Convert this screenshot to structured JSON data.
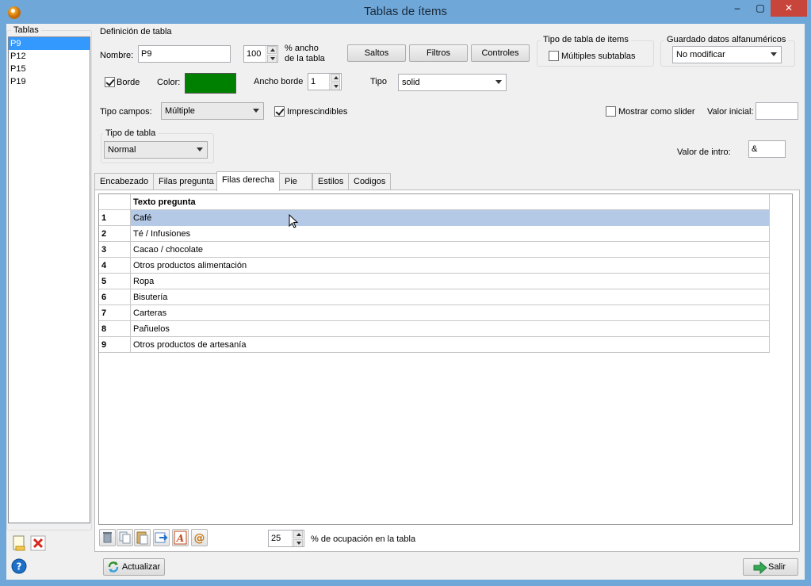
{
  "window": {
    "title": "Tablas de ítems",
    "minimize": "–",
    "maximize": "▢",
    "close": "✕"
  },
  "tables_panel": {
    "title": "Tablas",
    "items": [
      "P9",
      "P12",
      "P15",
      "P19"
    ],
    "selected": "P9"
  },
  "definition": {
    "group_title": "Definición de tabla",
    "name_label": "Nombre:",
    "name_value": "P9",
    "width_value": "100",
    "width_label_1": "% ancho",
    "width_label_2": "de la tabla",
    "btn_saltos": "Saltos",
    "btn_filtros": "Filtros",
    "btn_controles": "Controles",
    "border_label": "Borde",
    "border_checked": true,
    "color_label": "Color:",
    "color_value": "#008000",
    "border_width_label": "Ancho borde",
    "border_width_value": "1",
    "type_label": "Tipo",
    "type_value": "solid",
    "field_type_label": "Tipo campos:",
    "field_type_value": "Múltiple",
    "required_label": "Imprescindibles",
    "required_checked": true,
    "table_type_group": "Tipo de tabla",
    "table_type_value": "Normal"
  },
  "item_table_type": {
    "group_title": "Tipo de tabla de items",
    "multi_label": "Múltiples subtablas",
    "multi_checked": false
  },
  "alpha_data": {
    "group_title": "Guardado datos alfanuméricos",
    "value": "No modificar"
  },
  "slider": {
    "label": "Mostrar como slider",
    "checked": false,
    "initial_label": "Valor inicial:",
    "initial_value": ""
  },
  "intro": {
    "label": "Valor  de intro:",
    "value": "&"
  },
  "tabs": [
    {
      "label": "Encabezado",
      "active": false
    },
    {
      "label": "Filas pregunta",
      "active": false
    },
    {
      "label": "Filas derecha",
      "active": true
    },
    {
      "label": "Pie",
      "active": false
    },
    {
      "label": "Estilos",
      "active": false
    },
    {
      "label": "Codigos",
      "active": false
    }
  ],
  "grid": {
    "header": "Texto pregunta",
    "rows": [
      {
        "n": "1",
        "text": "Café"
      },
      {
        "n": "2",
        "text": "Té / Infusiones"
      },
      {
        "n": "3",
        "text": "Cacao / chocolate"
      },
      {
        "n": "4",
        "text": "Otros productos alimentación"
      },
      {
        "n": "5",
        "text": "Ropa"
      },
      {
        "n": "6",
        "text": "Bisutería"
      },
      {
        "n": "7",
        "text": "Carteras"
      },
      {
        "n": "8",
        "text": "Pañuelos"
      },
      {
        "n": "9",
        "text": "Otros productos de artesanía"
      }
    ],
    "selected_row": "1"
  },
  "grid_toolbar": {
    "occupation_value": "25",
    "occupation_label": "% de ocupación en la tabla"
  },
  "footer": {
    "update_label": "Actualizar",
    "exit_label": "Salir"
  },
  "icons": {
    "new": "new-document-icon",
    "delete": "delete-icon",
    "help": "help-icon",
    "trash": "trash-icon",
    "copy": "copy-icon",
    "paste": "paste-icon",
    "export": "export-icon",
    "font": "font-icon",
    "email": "at-icon",
    "refresh": "refresh-icon",
    "exit": "exit-arrow-icon"
  },
  "colors": {
    "window_frame": "#6fa7d9",
    "selection_list": "#3399ff",
    "selection_grid": "#b4c9e6",
    "close_button": "#c7453a"
  }
}
